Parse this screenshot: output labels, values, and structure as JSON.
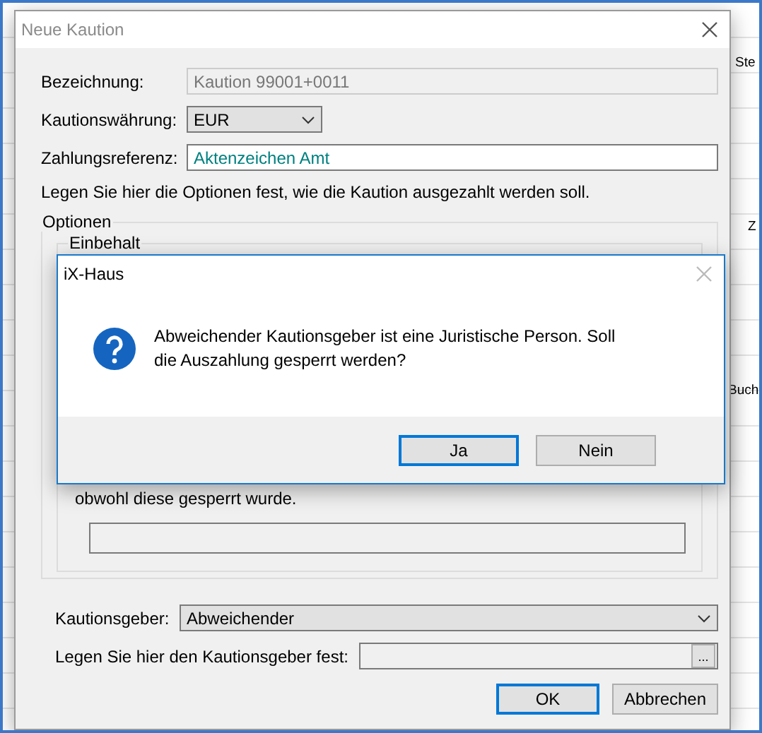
{
  "background_window": {
    "column_headers": [
      "Ste",
      "Z",
      "Buch"
    ]
  },
  "dialog": {
    "title": "Neue Kaution",
    "fields": [
      {
        "label": "Bezeichnung:",
        "kind": "readonly",
        "value": "Kaution 99001+0011"
      },
      {
        "label": "Kautionswährung:",
        "kind": "dropdown",
        "value": "EUR"
      },
      {
        "label": "Zahlungsreferenz:",
        "kind": "text",
        "value": "Aktenzeichen Amt"
      }
    ],
    "info": "Legen Sie hier die Optionen fest, wie die Kaution ausgezahlt werden soll.",
    "options_group": {
      "title": "Optionen",
      "retention_title": "Einbehalt",
      "info_text": "obwohl diese gesperrt wurde."
    },
    "depositor": {
      "label": "Kautionsgeber:",
      "value": "Abweichender"
    },
    "picker": {
      "label": "Legen Sie hier den Kautionsgeber fest:",
      "button": "..."
    },
    "buttons": [
      {
        "label": "OK",
        "default": true
      },
      {
        "label": "Abbrechen",
        "default": false
      }
    ]
  },
  "message_box": {
    "title": "iX-Haus",
    "message": "Abweichender Kautionsgeber ist eine Juristische Person. Soll die Auszahlung gesperrt werden?",
    "buttons": [
      {
        "label": "Ja",
        "default": true
      },
      {
        "label": "Nein",
        "default": false
      }
    ]
  }
}
